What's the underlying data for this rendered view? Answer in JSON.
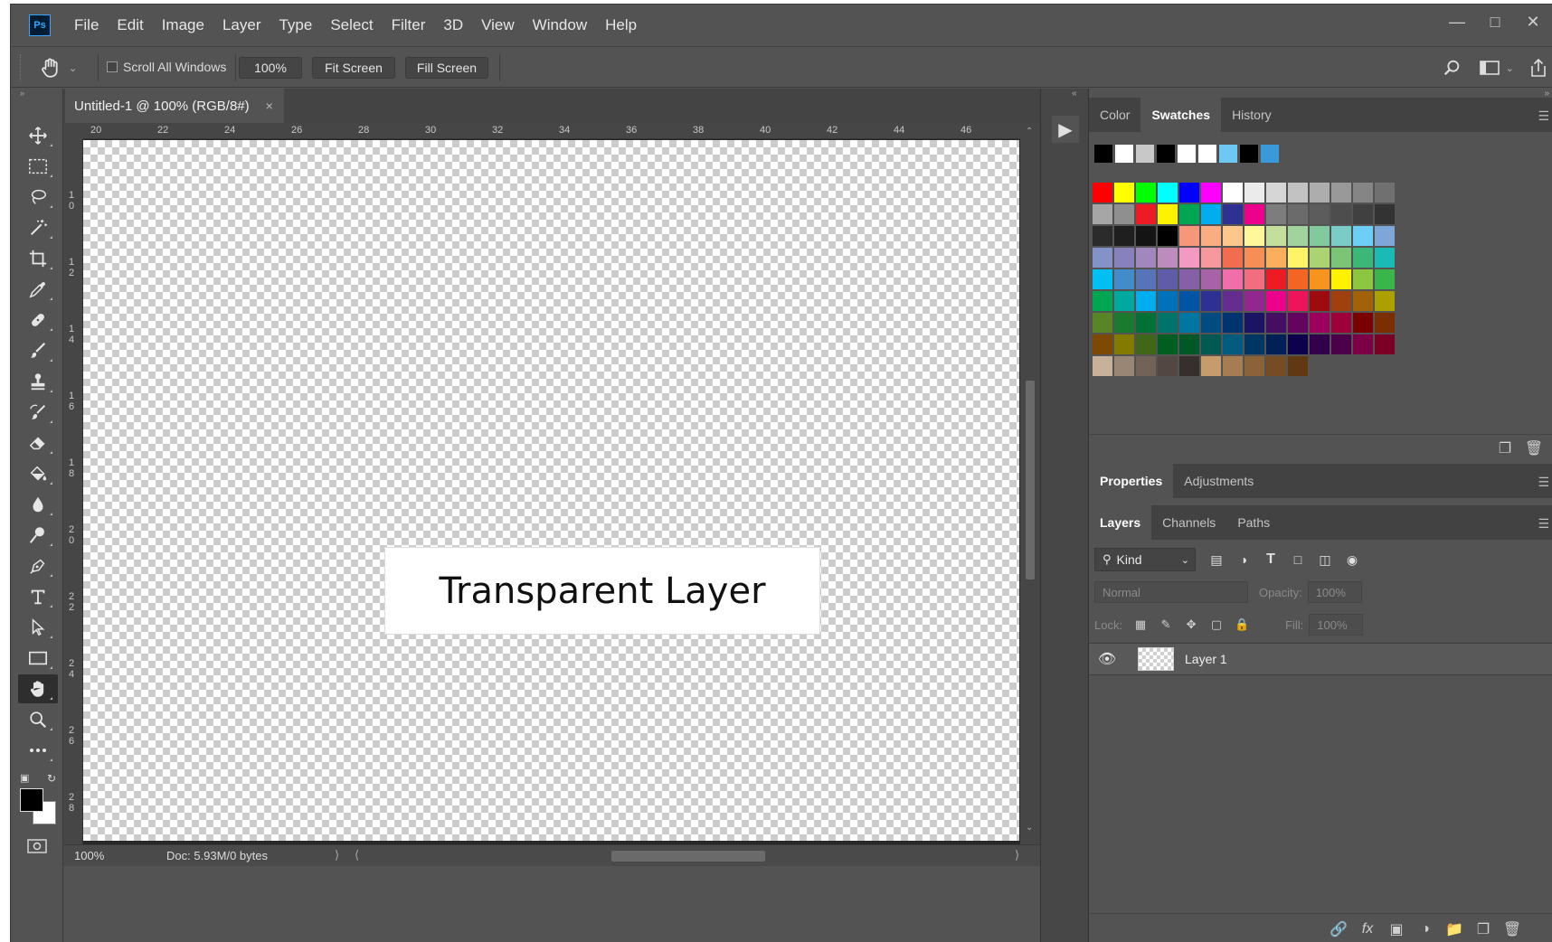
{
  "app": {
    "logo_text": "Ps",
    "menu": [
      "File",
      "Edit",
      "Image",
      "Layer",
      "Type",
      "Select",
      "Filter",
      "3D",
      "View",
      "Window",
      "Help"
    ]
  },
  "options": {
    "scroll_all_windows": "Scroll All Windows",
    "zoom_btn": "100%",
    "fit_screen": "Fit Screen",
    "fill_screen": "Fill Screen"
  },
  "document": {
    "tab_title": "Untitled-1 @ 100% (RGB/8#)",
    "close": "×",
    "ruler_h": [
      "20",
      "22",
      "24",
      "26",
      "28",
      "30",
      "32",
      "34",
      "36",
      "38",
      "40",
      "42",
      "44",
      "46"
    ],
    "ruler_v": [
      "10",
      "12",
      "14",
      "16",
      "18",
      "20",
      "22",
      "24",
      "26",
      "28"
    ],
    "canvas_text": "Transparent Layer",
    "status_zoom": "100%",
    "status_doc": "Doc: 5.93M/0 bytes"
  },
  "panels": {
    "color_tabs": [
      "Color",
      "Swatches",
      "History"
    ],
    "props_tabs": [
      "Properties",
      "Adjustments"
    ],
    "layers_tabs": [
      "Layers",
      "Channels",
      "Paths"
    ],
    "kind_label": "Kind",
    "blend_mode": "Normal",
    "opacity_label": "Opacity:",
    "opacity_value": "100%",
    "lock_label": "Lock:",
    "fill_label": "Fill:",
    "fill_value": "100%",
    "layer_name": "Layer 1"
  },
  "recent_swatches": [
    "#000000",
    "#ffffff",
    "#c8c8c8",
    "#000000",
    "#ffffff",
    "#ffffff",
    "#6ec8f4",
    "#000000",
    "#3a9ad9"
  ],
  "swatches": [
    "#ff0000",
    "#ffff00",
    "#00ff00",
    "#00ffff",
    "#0000ff",
    "#ff00ff",
    "#ffffff",
    "#ebebeb",
    "#d6d6d6",
    "#c2c2c2",
    "#adadad",
    "#999999",
    "#858585",
    "#707070",
    "#a6a6a6",
    "#8f8f8f",
    "#ed1c24",
    "#fff200",
    "#00a651",
    "#00aeef",
    "#2e3192",
    "#ec008c",
    "#7d7d7d",
    "#6b6b6b",
    "#5c5c5c",
    "#4d4d4d",
    "#404040",
    "#333333",
    "#2b2b2b",
    "#1f1f1f",
    "#141414",
    "#000000",
    "#f7977a",
    "#f9ad81",
    "#fdc68a",
    "#fff79a",
    "#c4df9b",
    "#a3d39c",
    "#82ca9d",
    "#7accc8",
    "#6dcff6",
    "#7da7d9",
    "#8393ca",
    "#8781bd",
    "#a187be",
    "#bd8cbf",
    "#f49ac2",
    "#f6989d",
    "#f26c4f",
    "#f68e55",
    "#fbaf5c",
    "#fff467",
    "#acd372",
    "#7cc576",
    "#3bb878",
    "#1abbb4",
    "#00bff3",
    "#438ccb",
    "#5574b9",
    "#605ca8",
    "#855fa8",
    "#a763a8",
    "#f06ea9",
    "#f26d7d",
    "#ed1c24",
    "#f26522",
    "#f7941d",
    "#fff200",
    "#8dc63f",
    "#39b54a",
    "#00a651",
    "#00a99d",
    "#00aeef",
    "#0072bc",
    "#0054a6",
    "#2e3192",
    "#662d91",
    "#92278f",
    "#ec008c",
    "#ed145b",
    "#9e0b0f",
    "#a0410d",
    "#a36209",
    "#aba000",
    "#598527",
    "#1a7b30",
    "#007236",
    "#00746b",
    "#0076a3",
    "#004b80",
    "#003471",
    "#1b1464",
    "#440e62",
    "#630460",
    "#9e005d",
    "#9e0039",
    "#790000",
    "#7b2e00",
    "#7d4900",
    "#827b00",
    "#406618",
    "#005e20",
    "#005826",
    "#005952",
    "#005b7f",
    "#003663",
    "#002157",
    "#0d004c",
    "#32004b",
    "#4b0049",
    "#7b0046",
    "#7a0026",
    "#c7b299",
    "#998675",
    "#736357",
    "#534741",
    "#362f2d",
    "#c69c6d",
    "#a67c52",
    "#8c6239",
    "#754c24",
    "#603913"
  ]
}
